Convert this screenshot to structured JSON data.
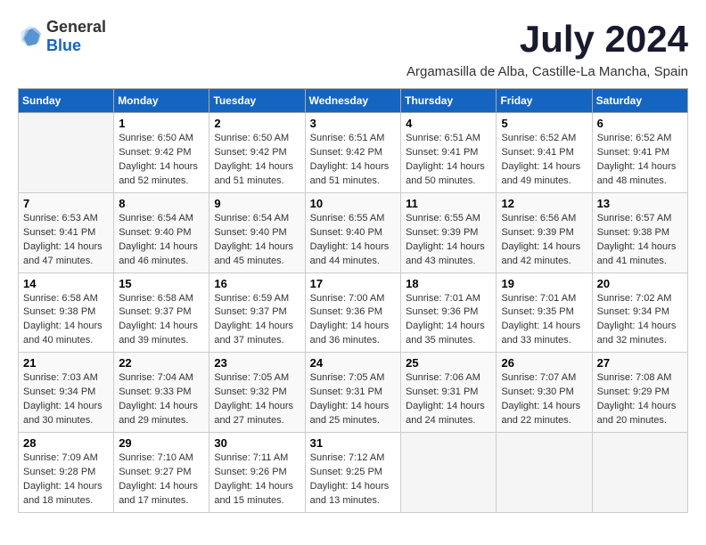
{
  "logo": {
    "general": "General",
    "blue": "Blue"
  },
  "title": "July 2024",
  "location": "Argamasilla de Alba, Castille-La Mancha, Spain",
  "days_of_week": [
    "Sunday",
    "Monday",
    "Tuesday",
    "Wednesday",
    "Thursday",
    "Friday",
    "Saturday"
  ],
  "weeks": [
    [
      {
        "day": "",
        "info": ""
      },
      {
        "day": "1",
        "info": "Sunrise: 6:50 AM\nSunset: 9:42 PM\nDaylight: 14 hours\nand 52 minutes."
      },
      {
        "day": "2",
        "info": "Sunrise: 6:50 AM\nSunset: 9:42 PM\nDaylight: 14 hours\nand 51 minutes."
      },
      {
        "day": "3",
        "info": "Sunrise: 6:51 AM\nSunset: 9:42 PM\nDaylight: 14 hours\nand 51 minutes."
      },
      {
        "day": "4",
        "info": "Sunrise: 6:51 AM\nSunset: 9:41 PM\nDaylight: 14 hours\nand 50 minutes."
      },
      {
        "day": "5",
        "info": "Sunrise: 6:52 AM\nSunset: 9:41 PM\nDaylight: 14 hours\nand 49 minutes."
      },
      {
        "day": "6",
        "info": "Sunrise: 6:52 AM\nSunset: 9:41 PM\nDaylight: 14 hours\nand 48 minutes."
      }
    ],
    [
      {
        "day": "7",
        "info": "Sunrise: 6:53 AM\nSunset: 9:41 PM\nDaylight: 14 hours\nand 47 minutes."
      },
      {
        "day": "8",
        "info": "Sunrise: 6:54 AM\nSunset: 9:40 PM\nDaylight: 14 hours\nand 46 minutes."
      },
      {
        "day": "9",
        "info": "Sunrise: 6:54 AM\nSunset: 9:40 PM\nDaylight: 14 hours\nand 45 minutes."
      },
      {
        "day": "10",
        "info": "Sunrise: 6:55 AM\nSunset: 9:40 PM\nDaylight: 14 hours\nand 44 minutes."
      },
      {
        "day": "11",
        "info": "Sunrise: 6:55 AM\nSunset: 9:39 PM\nDaylight: 14 hours\nand 43 minutes."
      },
      {
        "day": "12",
        "info": "Sunrise: 6:56 AM\nSunset: 9:39 PM\nDaylight: 14 hours\nand 42 minutes."
      },
      {
        "day": "13",
        "info": "Sunrise: 6:57 AM\nSunset: 9:38 PM\nDaylight: 14 hours\nand 41 minutes."
      }
    ],
    [
      {
        "day": "14",
        "info": "Sunrise: 6:58 AM\nSunset: 9:38 PM\nDaylight: 14 hours\nand 40 minutes."
      },
      {
        "day": "15",
        "info": "Sunrise: 6:58 AM\nSunset: 9:37 PM\nDaylight: 14 hours\nand 39 minutes."
      },
      {
        "day": "16",
        "info": "Sunrise: 6:59 AM\nSunset: 9:37 PM\nDaylight: 14 hours\nand 37 minutes."
      },
      {
        "day": "17",
        "info": "Sunrise: 7:00 AM\nSunset: 9:36 PM\nDaylight: 14 hours\nand 36 minutes."
      },
      {
        "day": "18",
        "info": "Sunrise: 7:01 AM\nSunset: 9:36 PM\nDaylight: 14 hours\nand 35 minutes."
      },
      {
        "day": "19",
        "info": "Sunrise: 7:01 AM\nSunset: 9:35 PM\nDaylight: 14 hours\nand 33 minutes."
      },
      {
        "day": "20",
        "info": "Sunrise: 7:02 AM\nSunset: 9:34 PM\nDaylight: 14 hours\nand 32 minutes."
      }
    ],
    [
      {
        "day": "21",
        "info": "Sunrise: 7:03 AM\nSunset: 9:34 PM\nDaylight: 14 hours\nand 30 minutes."
      },
      {
        "day": "22",
        "info": "Sunrise: 7:04 AM\nSunset: 9:33 PM\nDaylight: 14 hours\nand 29 minutes."
      },
      {
        "day": "23",
        "info": "Sunrise: 7:05 AM\nSunset: 9:32 PM\nDaylight: 14 hours\nand 27 minutes."
      },
      {
        "day": "24",
        "info": "Sunrise: 7:05 AM\nSunset: 9:31 PM\nDaylight: 14 hours\nand 25 minutes."
      },
      {
        "day": "25",
        "info": "Sunrise: 7:06 AM\nSunset: 9:31 PM\nDaylight: 14 hours\nand 24 minutes."
      },
      {
        "day": "26",
        "info": "Sunrise: 7:07 AM\nSunset: 9:30 PM\nDaylight: 14 hours\nand 22 minutes."
      },
      {
        "day": "27",
        "info": "Sunrise: 7:08 AM\nSunset: 9:29 PM\nDaylight: 14 hours\nand 20 minutes."
      }
    ],
    [
      {
        "day": "28",
        "info": "Sunrise: 7:09 AM\nSunset: 9:28 PM\nDaylight: 14 hours\nand 18 minutes."
      },
      {
        "day": "29",
        "info": "Sunrise: 7:10 AM\nSunset: 9:27 PM\nDaylight: 14 hours\nand 17 minutes."
      },
      {
        "day": "30",
        "info": "Sunrise: 7:11 AM\nSunset: 9:26 PM\nDaylight: 14 hours\nand 15 minutes."
      },
      {
        "day": "31",
        "info": "Sunrise: 7:12 AM\nSunset: 9:25 PM\nDaylight: 14 hours\nand 13 minutes."
      },
      {
        "day": "",
        "info": ""
      },
      {
        "day": "",
        "info": ""
      },
      {
        "day": "",
        "info": ""
      }
    ]
  ]
}
